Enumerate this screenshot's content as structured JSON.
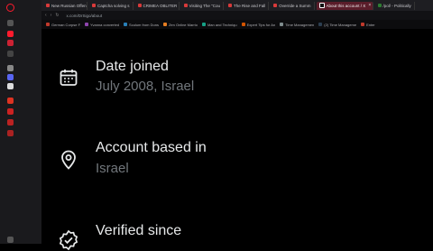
{
  "browser": {
    "tabs": [
      {
        "label": "New Russian Offen"
      },
      {
        "label": "Captcha solving s"
      },
      {
        "label": "CRIMEA OBLITER"
      },
      {
        "label": "Visiting The \"Cou"
      },
      {
        "label": "The Rise and Fall"
      },
      {
        "label": "Override a Summ"
      },
      {
        "label": "About this account / X",
        "active": true
      },
      {
        "label": "/pol/ - Politically"
      }
    ],
    "tab_close_glyph": "×",
    "url": "x.com/DrSigo/about",
    "bookmarks": [
      {
        "label": "German Corpse F",
        "color": "#c0392b"
      },
      {
        "label": "Yvanna converted",
        "color": "#8e44ad"
      },
      {
        "label": "Sculum from Duns",
        "color": "#2980b9"
      },
      {
        "label": "Zen Online Marrio",
        "color": "#e67e22"
      },
      {
        "label": "Man and Techniqu",
        "color": "#16a085"
      },
      {
        "label": "Expert Tips for An",
        "color": "#d35400"
      },
      {
        "label": "Time Managemen",
        "color": "#7f8c8d"
      },
      {
        "label": "(2) Time Manageme",
        "color": "#2c3e50"
      },
      {
        "label": "Enter",
        "color": "#c0392b"
      }
    ]
  },
  "about": {
    "date_joined_label": "Date joined",
    "date_joined_value": "July 2008, Israel",
    "account_based_label": "Account based in",
    "account_based_value": "Israel",
    "verified_label": "Verified since"
  },
  "icons": {
    "calendar": "calendar-icon",
    "location": "location-pin-icon",
    "verified": "verified-badge-icon"
  },
  "colors": {
    "primary_text": "#e7e9ea",
    "secondary_text": "#71767b",
    "accent": "#ff1b2d",
    "background": "#000000"
  }
}
